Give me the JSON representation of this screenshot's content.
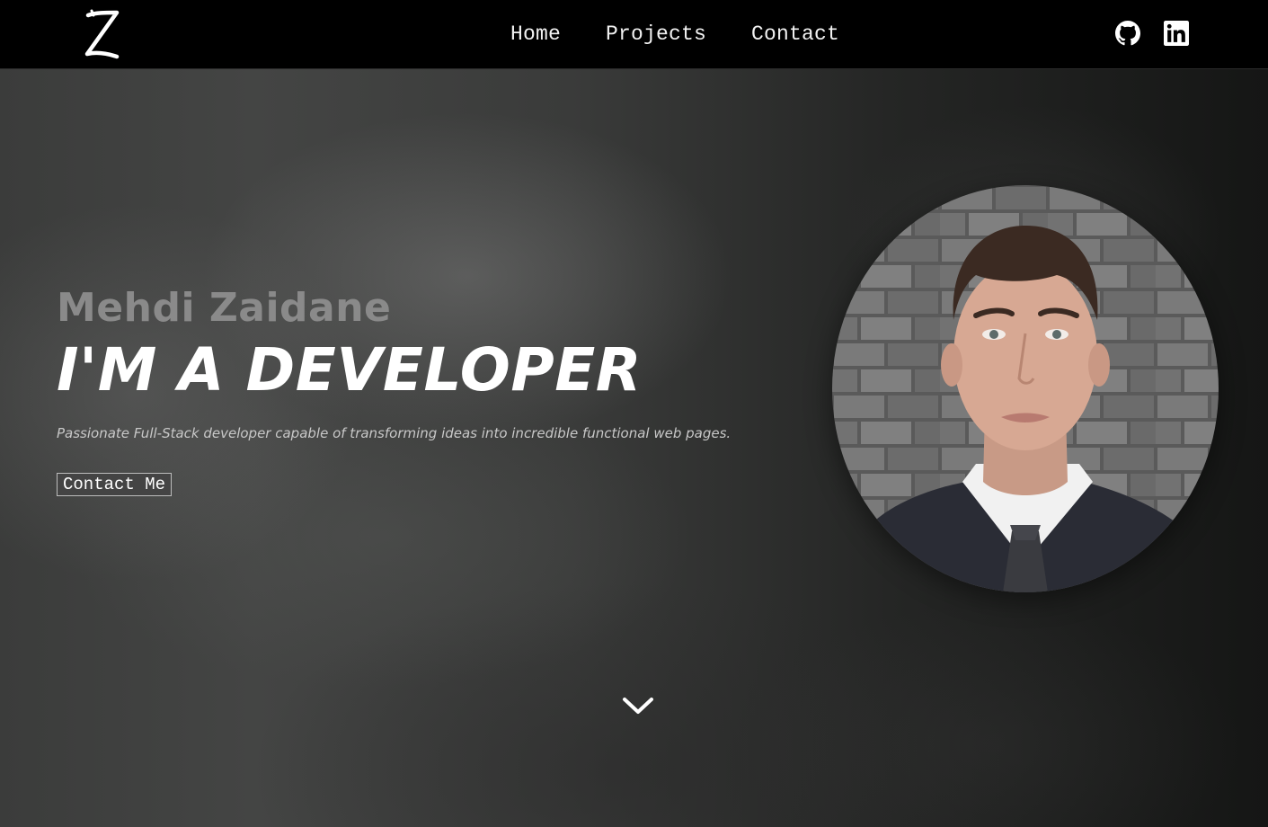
{
  "navbar": {
    "logo_icon": "z-logo-icon",
    "links": [
      {
        "label": "Home"
      },
      {
        "label": "Projects"
      },
      {
        "label": "Contact"
      }
    ],
    "social": [
      {
        "icon": "github-icon"
      },
      {
        "icon": "linkedin-icon"
      }
    ]
  },
  "hero": {
    "name": "Mehdi Zaidane",
    "title": "I'M A DEVELOPER",
    "tagline": "Passionate Full-Stack developer capable of transforming ideas into incredible functional web pages.",
    "cta_label": "Contact Me",
    "scroll_icon": "chevron-down-icon"
  },
  "colors": {
    "navbar_bg": "#000000",
    "name_color": "#8a8a8a",
    "button_bg": "#444444",
    "text": "#ffffff"
  }
}
